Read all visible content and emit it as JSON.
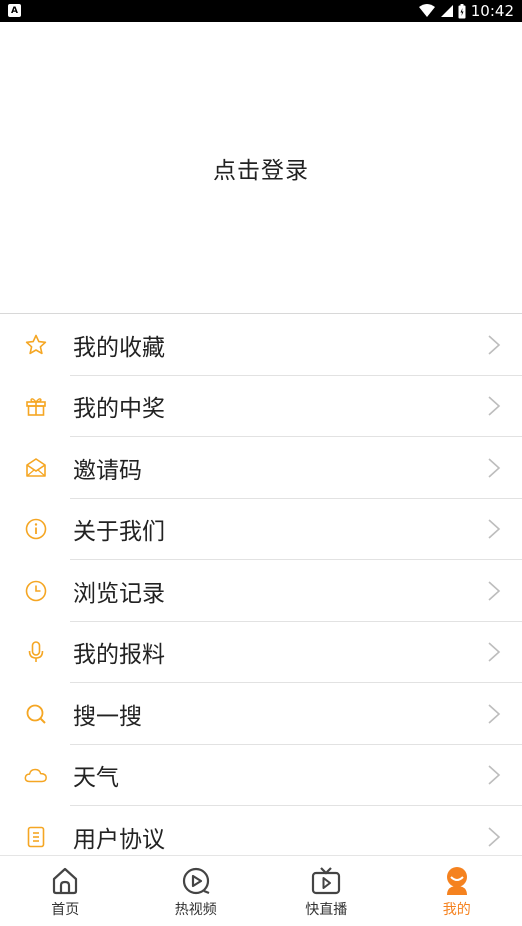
{
  "status_bar": {
    "time": "10:42",
    "left_glyph": "A"
  },
  "login": {
    "label": "点击登录"
  },
  "menu": {
    "items": [
      {
        "label": "我的收藏",
        "icon": "star-icon"
      },
      {
        "label": "我的中奖",
        "icon": "gift-icon"
      },
      {
        "label": "邀请码",
        "icon": "envelope-icon"
      },
      {
        "label": "关于我们",
        "icon": "info-icon"
      },
      {
        "label": "浏览记录",
        "icon": "clock-icon"
      },
      {
        "label": "我的报料",
        "icon": "microphone-icon"
      },
      {
        "label": "搜一搜",
        "icon": "search-icon"
      },
      {
        "label": "天气",
        "icon": "cloud-icon"
      },
      {
        "label": "用户协议",
        "icon": "document-icon"
      }
    ]
  },
  "tabs": [
    {
      "label": "首页",
      "icon": "home-icon",
      "active": false
    },
    {
      "label": "热视频",
      "icon": "video-play-icon",
      "active": false
    },
    {
      "label": "快直播",
      "icon": "tv-icon",
      "active": false
    },
    {
      "label": "我的",
      "icon": "profile-icon",
      "active": true
    }
  ],
  "colors": {
    "accent": "#f5821f",
    "icon_orange": "#f5a623",
    "text": "#222222"
  }
}
